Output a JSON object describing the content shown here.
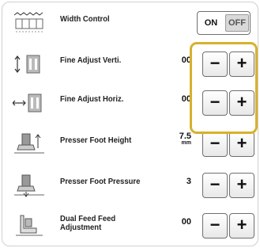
{
  "rows": [
    {
      "label": "Width Control",
      "toggle": {
        "on": "ON",
        "off": "OFF"
      }
    },
    {
      "label": "Fine Adjust Verti.",
      "value": "00",
      "minus": "−",
      "plus": "+"
    },
    {
      "label": "Fine Adjust Horiz.",
      "value": "00",
      "minus": "−",
      "plus": "+"
    },
    {
      "label": "Presser Foot Height",
      "value": "7.5",
      "unit": "mm",
      "minus": "−",
      "plus": "+"
    },
    {
      "label": "Presser Foot Pressure",
      "value": "3",
      "minus": "−",
      "plus": "+"
    },
    {
      "label_line1": "Dual Feed Feed",
      "label_line2": "Adjustment",
      "value": "00",
      "minus": "−",
      "plus": "+"
    }
  ],
  "colors": {
    "highlight": "#d8b12b",
    "button_border": "#6f6f6f"
  },
  "icons": [
    "width-control-icon",
    "fine-adjust-vertical-icon",
    "fine-adjust-horizontal-icon",
    "presser-foot-height-icon",
    "presser-foot-pressure-icon",
    "dual-feed-icon"
  ]
}
